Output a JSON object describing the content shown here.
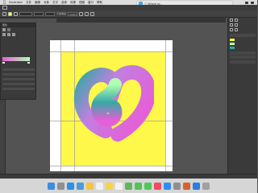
{
  "menubar": {
    "apple": "",
    "items": [
      "Illustrator",
      "文件",
      "编辑",
      "对象",
      "文字",
      "选择",
      "效果",
      "视图",
      "窗口",
      "帮助"
    ],
    "window_title": "",
    "status": [
      "",
      ""
    ]
  },
  "notification": {
    "text": "ⓘ Where to..."
  },
  "options_bar": {
    "stroke_value": "",
    "style_label": "不透明度",
    "opacity_value": "100%"
  },
  "tabs": [
    ""
  ],
  "props_panel": {
    "header": "属性"
  },
  "canvas": {
    "heart_colors": {
      "magenta": "#e55fd8",
      "teal": "#38a7a6",
      "mint": "#b0ffb0",
      "yellow": "#fdf84a"
    }
  },
  "status_bar": {
    "text": ""
  },
  "dock": {
    "apps": [
      "finder-icon",
      "launchpad-icon",
      "safari-icon",
      "mail-icon",
      "photos-icon",
      "calendar-icon",
      "notes-icon",
      "reminders-icon",
      "maps-icon",
      "facetime-icon",
      "messages-icon",
      "music-icon",
      "appstore-icon",
      "settings-icon",
      "illustrator-icon",
      "photoshop-icon",
      "trash-icon"
    ],
    "colors": [
      "#3b8de0",
      "#8f8f8f",
      "#2f8fe0",
      "#4a9bdc",
      "#f5c542",
      "#f0f0f0",
      "#f7d24a",
      "#f2f2f2",
      "#61b55d",
      "#53c25a",
      "#4fc75a",
      "#f24b62",
      "#2e8ff5",
      "#8e8e93",
      "#d9622b",
      "#2b7de0",
      "#a0a0a0"
    ]
  }
}
